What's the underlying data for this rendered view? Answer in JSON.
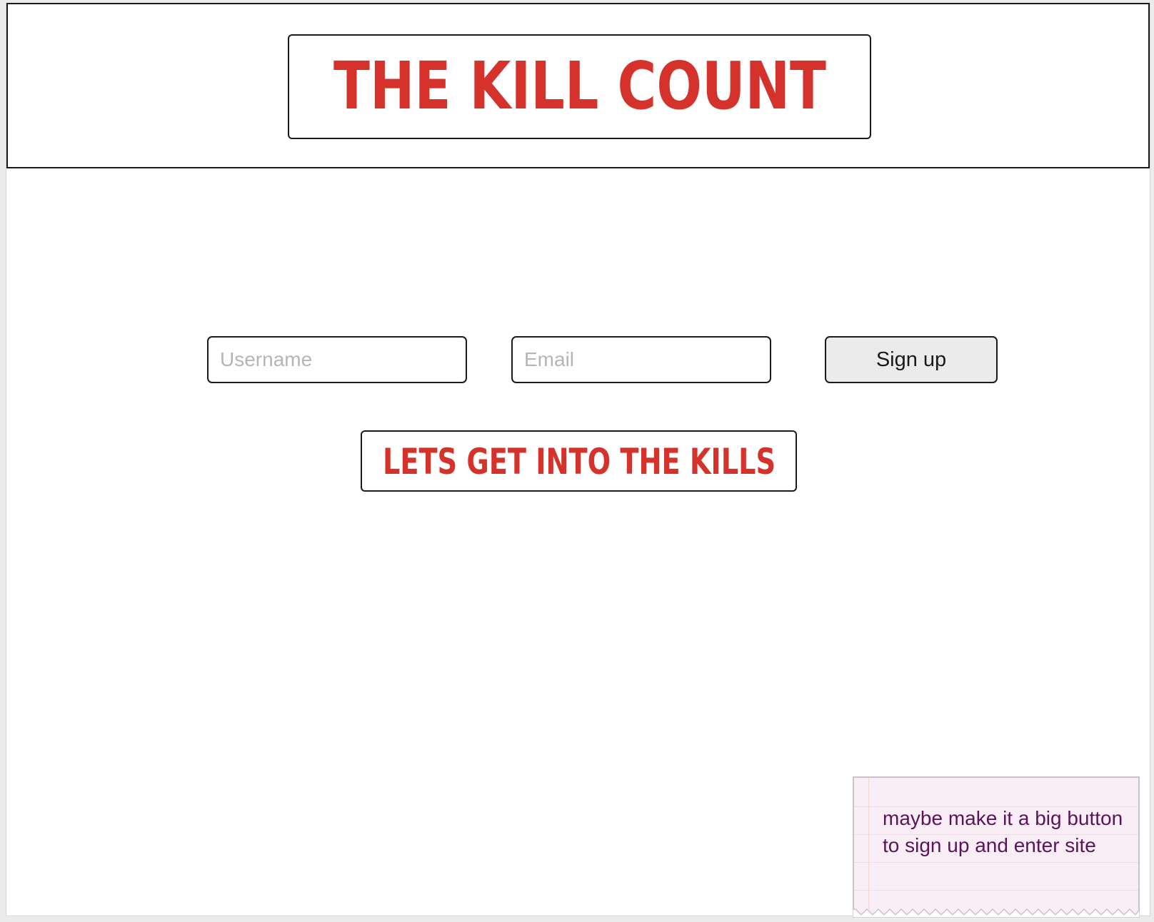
{
  "header": {
    "logo_text": "THE KILL COUNT"
  },
  "form": {
    "username_placeholder": "Username",
    "email_placeholder": "Email",
    "signup_label": "Sign up"
  },
  "enter_button": {
    "label": "LETS GET INTO THE KILLS"
  },
  "sticky_note": {
    "text": "maybe make it a big button to sign up and enter site"
  },
  "colors": {
    "accent": "#d4322a",
    "note_text": "#5a1558",
    "note_bg": "#f9eef5"
  }
}
